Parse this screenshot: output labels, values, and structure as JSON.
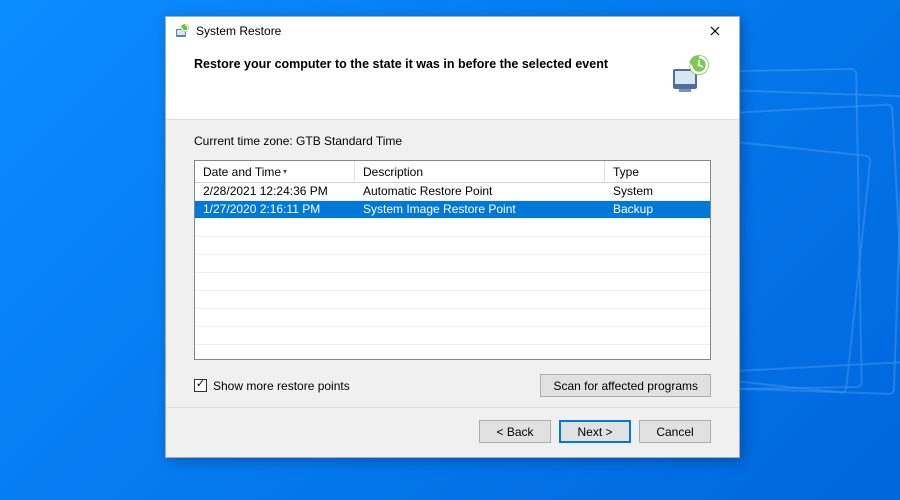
{
  "titlebar": {
    "title": "System Restore"
  },
  "header": {
    "heading": "Restore your computer to the state it was in before the selected event"
  },
  "content": {
    "timezone_label": "Current time zone: GTB Standard Time",
    "columns": {
      "date": "Date and Time",
      "desc": "Description",
      "type": "Type"
    },
    "rows": [
      {
        "date": "2/28/2021 12:24:36 PM",
        "desc": "Automatic Restore Point",
        "type": "System",
        "selected": false
      },
      {
        "date": "1/27/2020 2:16:11 PM",
        "desc": "System Image Restore Point",
        "type": "Backup",
        "selected": true
      }
    ],
    "show_more": {
      "label": "Show more restore points",
      "checked": true
    },
    "scan_button": "Scan for affected programs"
  },
  "footer": {
    "back": "< Back",
    "next": "Next >",
    "cancel": "Cancel"
  }
}
